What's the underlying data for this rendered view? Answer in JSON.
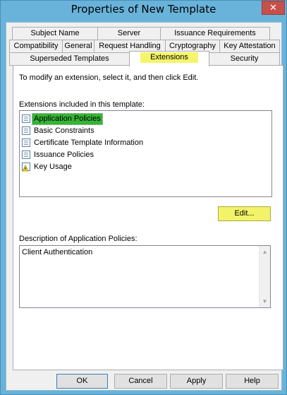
{
  "window": {
    "title": "Properties of New Template",
    "close_glyph": "✕"
  },
  "tabs": {
    "row1": [
      "Subject Name",
      "Server",
      "Issuance Requirements"
    ],
    "row2": [
      "Compatibility",
      "General",
      "Request Handling",
      "Cryptography",
      "Key Attestation"
    ],
    "row3": [
      "Superseded Templates",
      "Extensions",
      "Security"
    ],
    "active": "Extensions"
  },
  "instructions": "To modify an extension, select it, and then click Edit.",
  "extensions": {
    "label": "Extensions included in this template:",
    "items": [
      {
        "label": "Application Policies",
        "icon": "certificate-extension-icon",
        "selected": true
      },
      {
        "label": "Basic Constraints",
        "icon": "certificate-extension-icon",
        "selected": false
      },
      {
        "label": "Certificate Template Information",
        "icon": "certificate-extension-icon",
        "selected": false
      },
      {
        "label": "Issuance Policies",
        "icon": "certificate-extension-icon",
        "selected": false
      },
      {
        "label": "Key Usage",
        "icon": "key-usage-warning-icon",
        "selected": false
      }
    ]
  },
  "edit_button": "Edit...",
  "description": {
    "label": "Description of Application Policies:",
    "text": "Client Authentication"
  },
  "buttons": {
    "ok": "OK",
    "cancel": "Cancel",
    "apply": "Apply",
    "help": "Help"
  },
  "colors": {
    "title_bar": "#69b3da",
    "highlight": "#f5f56b",
    "selection": "#36b436",
    "close": "#c7504a"
  }
}
